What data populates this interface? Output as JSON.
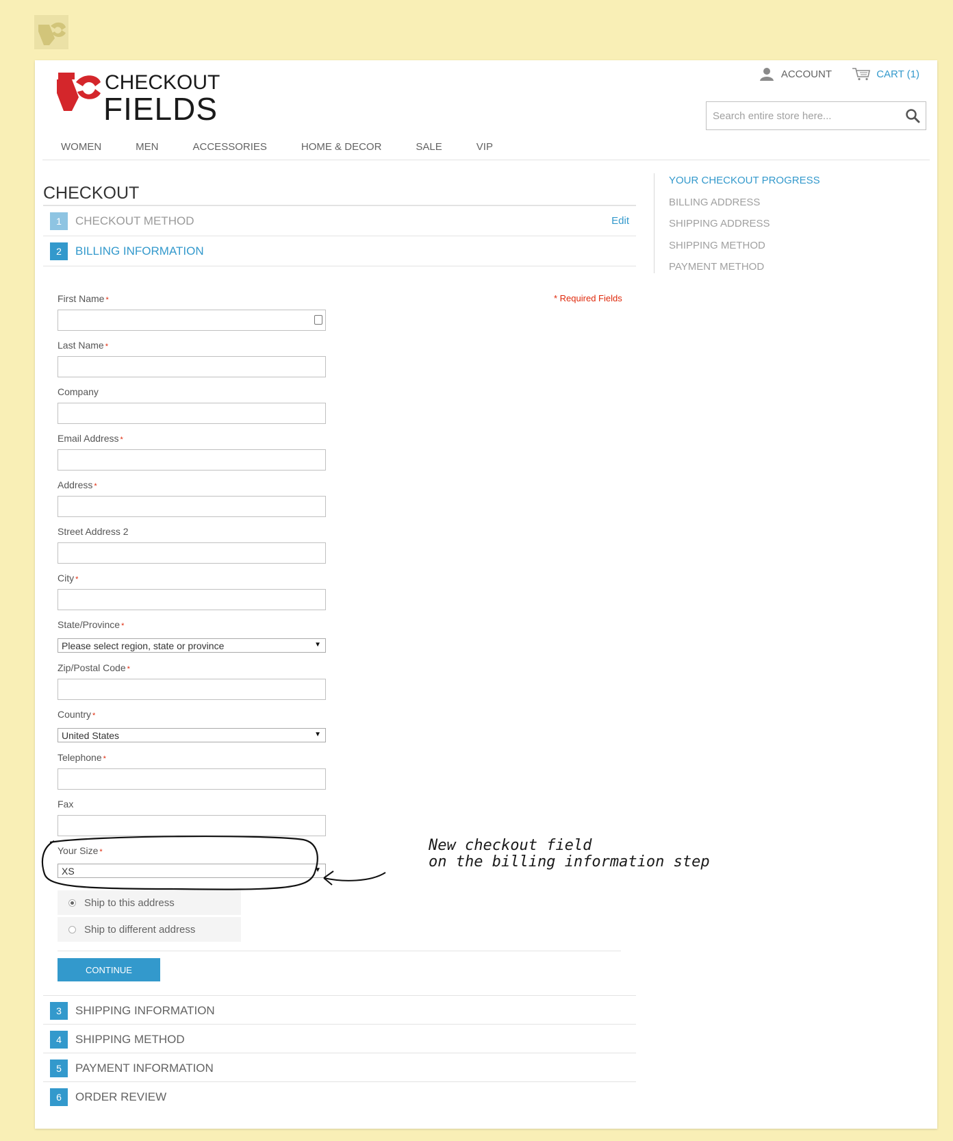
{
  "header": {
    "brand_line1": "CHECKOUT",
    "brand_line2": "FIELDS",
    "account_label": "ACCOUNT",
    "cart_label": "CART (1)",
    "search_placeholder": "Search entire store here..."
  },
  "nav": [
    "WOMEN",
    "MEN",
    "ACCESSORIES",
    "HOME & DECOR",
    "SALE",
    "VIP"
  ],
  "page_title": "CHECKOUT",
  "steps": [
    {
      "num": "1",
      "label": "CHECKOUT METHOD",
      "edit": "Edit"
    },
    {
      "num": "2",
      "label": "BILLING INFORMATION"
    },
    {
      "num": "3",
      "label": "SHIPPING INFORMATION"
    },
    {
      "num": "4",
      "label": "SHIPPING METHOD"
    },
    {
      "num": "5",
      "label": "PAYMENT INFORMATION"
    },
    {
      "num": "6",
      "label": "ORDER REVIEW"
    }
  ],
  "form": {
    "required_note": "* Required Fields",
    "first_name": "First Name",
    "last_name": "Last Name",
    "company": "Company",
    "email": "Email Address",
    "address": "Address",
    "street2": "Street Address 2",
    "city": "City",
    "state": "State/Province",
    "state_value": "Please select region, state or province",
    "zip": "Zip/Postal Code",
    "country": "Country",
    "country_value": "United States",
    "telephone": "Telephone",
    "fax": "Fax",
    "size": "Your Size",
    "size_value": "XS",
    "ship_same": "Ship to this address",
    "ship_diff": "Ship to different address",
    "continue": "CONTINUE"
  },
  "sidebar": {
    "title": "YOUR CHECKOUT PROGRESS",
    "items": [
      "BILLING ADDRESS",
      "SHIPPING ADDRESS",
      "SHIPPING METHOD",
      "PAYMENT METHOD"
    ]
  },
  "annotation": {
    "line1": "New checkout field",
    "line2": "on the billing information step"
  },
  "colors": {
    "accent": "#3399cc",
    "required": "#df280a",
    "background": "#f9efb6",
    "logo_red": "#d4262b"
  }
}
